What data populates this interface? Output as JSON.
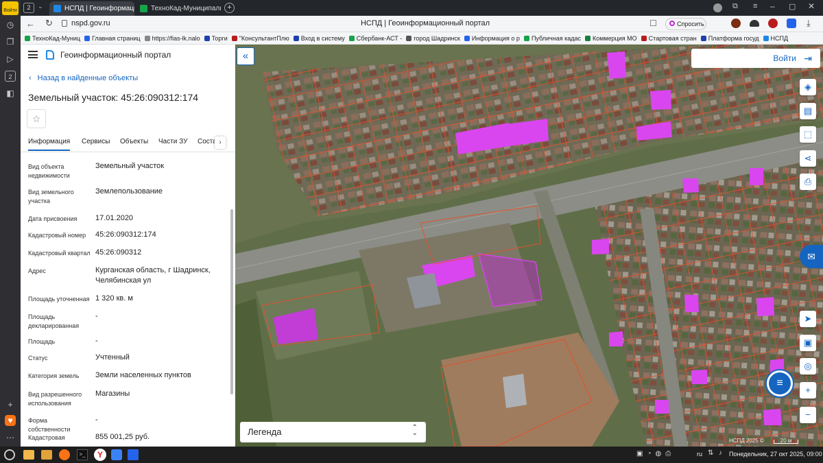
{
  "os_sidebar": {
    "top_label": "Войти"
  },
  "browser": {
    "tabs": [
      {
        "label": "НСПД | Геоинформацио",
        "active": true,
        "color": "#1e88e5"
      },
      {
        "label": "ТехноКад-Муниципалите",
        "active": false,
        "color": "#16a34a"
      }
    ],
    "tab_count": "2",
    "url": "nspd.gov.ru",
    "page_title": "НСПД | Геоинформационный портал",
    "ask_label": "Спросить",
    "bookmarks": [
      {
        "label": "ТехноКад-Муниц",
        "color": "#16a34a"
      },
      {
        "label": "Главная страниц",
        "color": "#2563eb"
      },
      {
        "label": "https://fias-lk.nalo",
        "color": "#888"
      },
      {
        "label": "Торги",
        "color": "#1e40af"
      },
      {
        "label": "\"КонсультантПлю",
        "color": "#b91c1c"
      },
      {
        "label": "Вход в систему",
        "color": "#1e40af"
      },
      {
        "label": "Сбербанк-АСТ -",
        "color": "#16a34a"
      },
      {
        "label": "город Шадринск",
        "color": "#555"
      },
      {
        "label": "Информация о р",
        "color": "#2563eb"
      },
      {
        "label": "Публичная кадас",
        "color": "#16a34a"
      },
      {
        "label": "Коммерция МО",
        "color": "#15803d"
      },
      {
        "label": "Стартовая стран",
        "color": "#b91c1c"
      },
      {
        "label": "Платформа госуд",
        "color": "#1e40af"
      },
      {
        "label": "НСПД",
        "color": "#1e88e5"
      }
    ]
  },
  "portal": {
    "title": "Геоинформационный портал",
    "back_link": "Назад в найденные объекты",
    "object_title": "Земельный участок: 45:26:090312:174",
    "tabs": [
      "Информация",
      "Сервисы",
      "Объекты",
      "Части ЗУ",
      "Соста"
    ],
    "active_tab": "Информация",
    "fields": [
      {
        "label": "Вид объекта недвижимости",
        "value": "Земельный участок"
      },
      {
        "label": "Вид земельного участка",
        "value": "Землепользование"
      },
      {
        "label": "Дата присвоения",
        "value": "17.01.2020"
      },
      {
        "label": "Кадастровый номер",
        "value": "45:26:090312:174"
      },
      {
        "label": "Кадастровый квартал",
        "value": "45:26:090312"
      },
      {
        "label": "Адрес",
        "value": "Курганская область, г Шадринск, Челябинская ул"
      },
      {
        "label": "Площадь уточненная",
        "value": "1 320 кв. м"
      },
      {
        "label": "Площадь декларированная",
        "value": "-"
      },
      {
        "label": "Площадь",
        "value": "-"
      },
      {
        "label": "Статус",
        "value": "Учтенный"
      },
      {
        "label": "Категория земель",
        "value": "Земли населенных пунктов"
      },
      {
        "label": "Вид разрешенного использования",
        "value": "Магазины"
      },
      {
        "label": "Форма собственности",
        "value": "-"
      },
      {
        "label": "Кадастровая",
        "value": "855 001,25 руб."
      }
    ]
  },
  "map": {
    "login_label": "Войти",
    "legend_label": "Легенда",
    "attribution": "НСПД 2025 ©",
    "scale_label": "20 м",
    "accent_color": "#1565c0",
    "highlight_color": "#d946ef"
  },
  "taskbar": {
    "lang": "ru",
    "datetime": "Понедельник, 27 окт 2025, 09:00"
  }
}
